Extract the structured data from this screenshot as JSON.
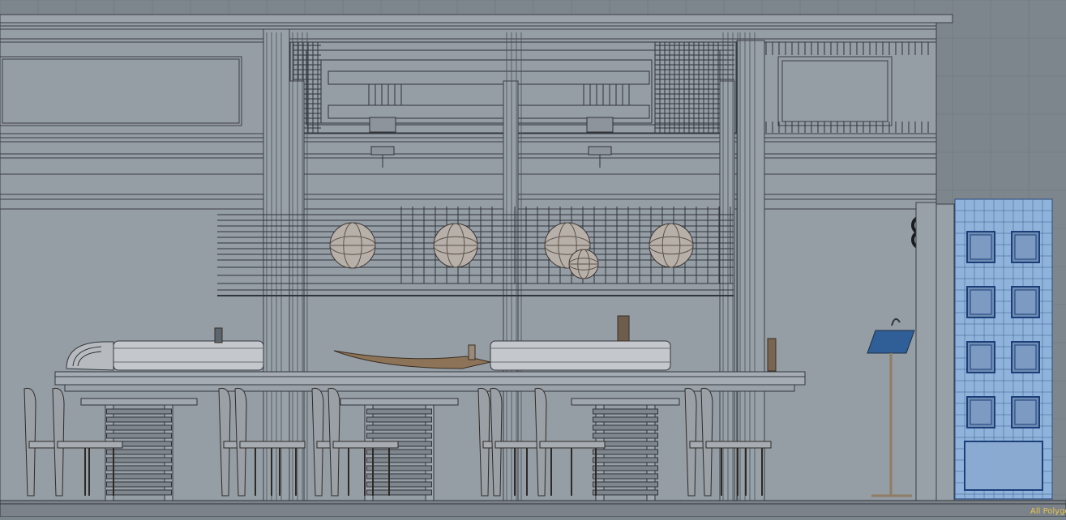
{
  "viewport": {
    "mode": "wireframe-on-shaded",
    "colors": {
      "background": "#7d858d",
      "wall": "#98a0a8",
      "grid": "#6f777f",
      "wire": "#3a3f44",
      "wire_light": "#5a6168",
      "metal": "#c9ccd0",
      "wood": "#9b8468",
      "selected_panel": "#8fb3da",
      "selected_wire": "#1c3f7a",
      "status_text": "#e8c34a"
    }
  },
  "status": {
    "label": "All Polygons"
  }
}
